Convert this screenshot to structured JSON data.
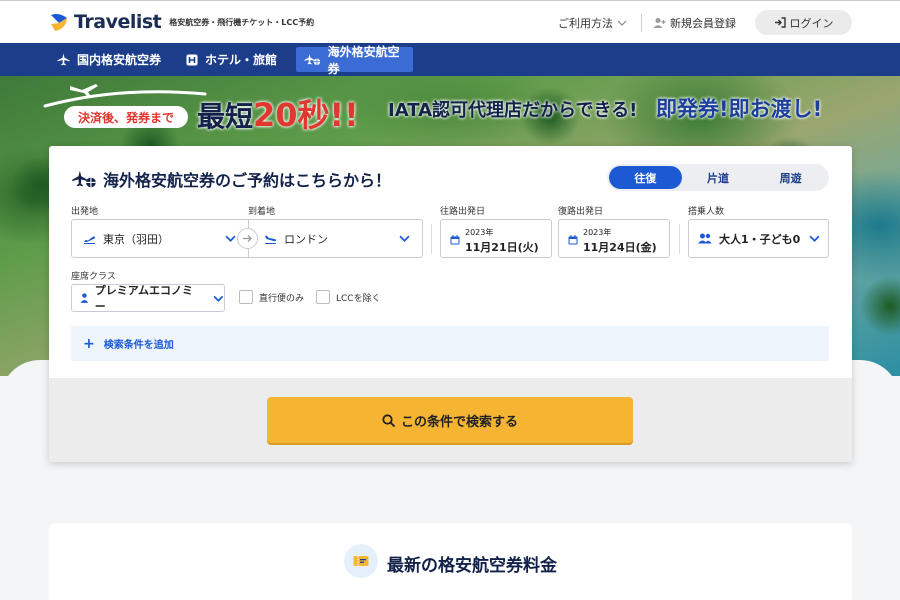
{
  "header": {
    "logo_text": "Travelist",
    "tagline": "格安航空券・飛行機チケット・LCC予約",
    "help_label": "ご利用方法",
    "register_label": "新規会員登録",
    "login_label": "ログイン"
  },
  "nav": {
    "tabs": [
      {
        "label": "国内格安航空券",
        "active": false
      },
      {
        "label": "ホテル・旅館",
        "active": false
      },
      {
        "label": "海外格安航空券",
        "active": true
      }
    ]
  },
  "banner": {
    "pill": "決済後、発券まで",
    "prefix": "最短",
    "number": "20",
    "suffix": "秒!!",
    "middle": "IATA認可代理店だからできる!",
    "highlight": "即発券!即お渡し!"
  },
  "search": {
    "title": "海外格安航空券のご予約はこちらから！",
    "trip_types": [
      "往復",
      "片道",
      "周遊"
    ],
    "trip_selected": "往復",
    "origin_label": "出発地",
    "origin_value": "東京（羽田）",
    "destination_label": "到着地",
    "destination_value": "ロンドン",
    "depart_label": "往路出発日",
    "depart_year": "2023年",
    "depart_date": "11月21日(火)",
    "return_label": "復路出発日",
    "return_year": "2023年",
    "return_date": "11月24日(金)",
    "pax_label": "搭乗人数",
    "pax_value": "大人1・子ども0",
    "cabin_label": "座席クラス",
    "cabin_value": "プレミアムエコノミー",
    "direct_only": "直行便のみ",
    "exclude_lcc": "LCCを除く",
    "add_conditions": "検索条件を追加",
    "submit": "この条件で検索する"
  },
  "fares": {
    "title": "最新の格安航空券料金"
  },
  "colors": {
    "navy": "#1c3d8a",
    "accent_blue": "#1c5ad4",
    "button_yellow": "#f5b533",
    "banner_red": "#e0382e"
  }
}
